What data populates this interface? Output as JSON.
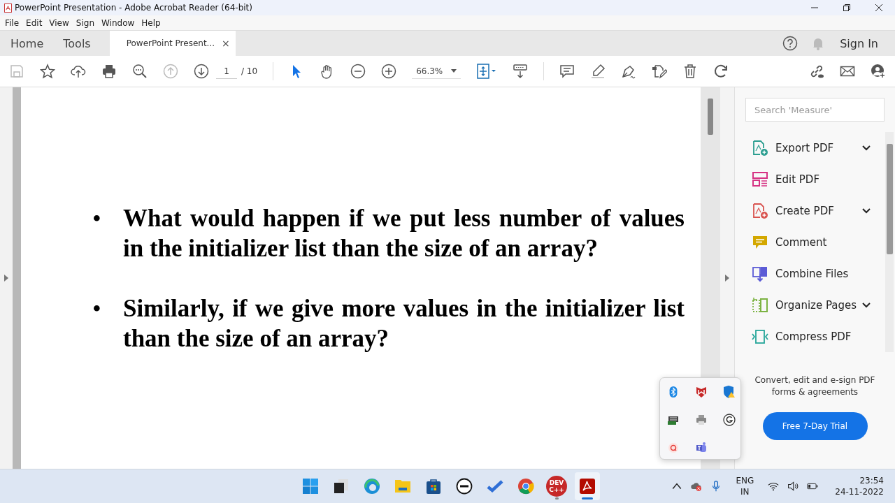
{
  "window": {
    "title": "PowerPoint Presentation - Adobe Acrobat Reader (64-bit)"
  },
  "menu": [
    "File",
    "Edit",
    "View",
    "Sign",
    "Window",
    "Help"
  ],
  "tabs": [
    {
      "label": "Home",
      "selected": false,
      "kind": "nav"
    },
    {
      "label": "Tools",
      "selected": false,
      "kind": "nav"
    },
    {
      "label": "PowerPoint Present...",
      "selected": true,
      "kind": "document",
      "close": "×"
    }
  ],
  "header_right": {
    "sign_in": "Sign In"
  },
  "toolbar": {
    "page": "1",
    "page_total": "/ 10",
    "zoom": "66.3%",
    "previous_page_disabled": true,
    "select_tool_selected": true
  },
  "document": {
    "bullets": [
      {
        "bullet": "•",
        "text": "What would happen if we put less number of values in the initializer list than the size of an array?"
      },
      {
        "bullet": "•",
        "text": "Similarly, if we give more values in the initializer list than the size of an array?"
      }
    ]
  },
  "tools_panel": {
    "search": {
      "placeholder": "Search 'Measure'"
    },
    "items": [
      {
        "label": "Export PDF",
        "kind": "dropdown"
      },
      {
        "label": "Edit PDF",
        "kind": "plain"
      },
      {
        "label": "Create PDF",
        "kind": "dropdown"
      },
      {
        "label": "Comment",
        "kind": "plain"
      },
      {
        "label": "Combine Files",
        "kind": "plain"
      },
      {
        "label": "Organize Pages",
        "kind": "dropdown"
      },
      {
        "label": "Compress PDF",
        "kind": "plain"
      }
    ],
    "promo": {
      "text": "Convert, edit and e-sign PDF forms & agreements",
      "button": "Free 7-Day Trial"
    }
  },
  "taskbar": {
    "apps": [
      {
        "kind": "start",
        "running": false,
        "selected": false
      },
      {
        "kind": "taskview",
        "running": false,
        "selected": false
      },
      {
        "kind": "edge",
        "running": false,
        "selected": false
      },
      {
        "kind": "explorer",
        "running": false,
        "selected": false
      },
      {
        "kind": "store",
        "running": false,
        "selected": false
      },
      {
        "kind": "dell",
        "running": false,
        "selected": false
      },
      {
        "kind": "todo",
        "running": false,
        "selected": false
      },
      {
        "kind": "chrome",
        "running": false,
        "selected": false
      },
      {
        "kind": "devcpp",
        "running": true,
        "selected": false,
        "label": "DEV C++"
      },
      {
        "kind": "acrobat",
        "running": true,
        "selected": true
      }
    ],
    "language": "ENG",
    "region": "IN",
    "time": "23:54",
    "date": "24-11-2022"
  }
}
